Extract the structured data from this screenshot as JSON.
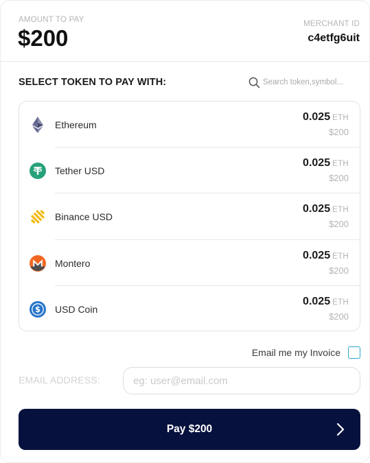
{
  "header": {
    "amount_label": "AMOUNT TO PAY",
    "amount_value": "$200",
    "merchant_label": "MERCHANT ID",
    "merchant_value": "c4etfg6uit"
  },
  "select": {
    "title": "SELECT TOKEN TO PAY WITH:",
    "search_placeholder": "Search token,symbol..."
  },
  "tokens": [
    {
      "name": "Ethereum",
      "icon": "ethereum-icon",
      "amount": "0.025",
      "unit": "ETH",
      "fiat": "$200",
      "color": "#627eea"
    },
    {
      "name": "Tether USD",
      "icon": "tether-icon",
      "amount": "0.025",
      "unit": "ETH",
      "fiat": "$200",
      "color": "#26a17b"
    },
    {
      "name": "Binance USD",
      "icon": "binance-usd-icon",
      "amount": "0.025",
      "unit": "ETH",
      "fiat": "$200",
      "color": "#f0b90b"
    },
    {
      "name": "Montero",
      "icon": "monero-icon",
      "amount": "0.025",
      "unit": "ETH",
      "fiat": "$200",
      "color": "#f26822"
    },
    {
      "name": "USD Coin",
      "icon": "usd-coin-icon",
      "amount": "0.025",
      "unit": "ETH",
      "fiat": "$200",
      "color": "#2775ca"
    }
  ],
  "email_me": {
    "label": "Email me my Invoice",
    "checked": false
  },
  "email": {
    "label": "EMAIL ADDRESS:",
    "placeholder": "eg: user@email.com",
    "value": ""
  },
  "pay_button": {
    "label": "Pay $200",
    "background": "#07113d"
  }
}
